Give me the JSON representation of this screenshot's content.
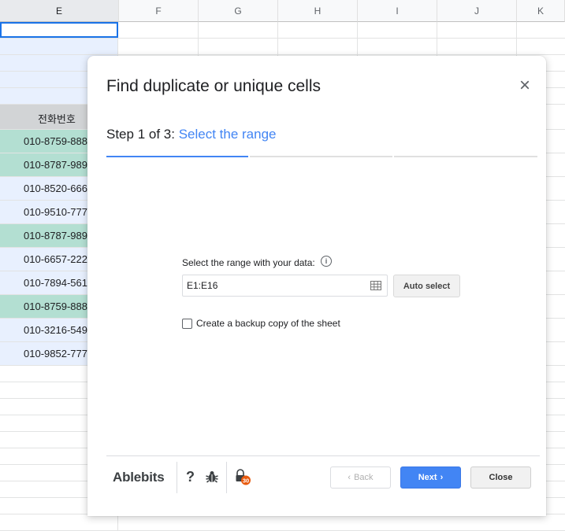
{
  "sheet": {
    "columns": [
      "E",
      "F",
      "G",
      "H",
      "I",
      "J",
      "K"
    ],
    "header_cell": "전화번호",
    "cells": [
      {
        "value": "010-8759-888",
        "highlight": true
      },
      {
        "value": "010-8787-989",
        "highlight": true
      },
      {
        "value": "010-8520-666",
        "highlight": false
      },
      {
        "value": "010-9510-777",
        "highlight": false
      },
      {
        "value": "010-8787-989",
        "highlight": true
      },
      {
        "value": "010-6657-222",
        "highlight": false
      },
      {
        "value": "010-7894-561",
        "highlight": false
      },
      {
        "value": "010-8759-888",
        "highlight": true
      },
      {
        "value": "010-3216-549",
        "highlight": false
      },
      {
        "value": "010-9852-777",
        "highlight": false
      }
    ],
    "colors": {
      "highlight": "#b3dfd2",
      "selected": "#e8f0fe",
      "header_bg": "#d2d4d6"
    }
  },
  "dialog": {
    "title": "Find duplicate or unique cells",
    "close_icon": "×",
    "step_prefix": "Step 1 of 3:",
    "step_name": "Select the range",
    "range_label": "Select the range with your data:",
    "info_icon": "i",
    "range_value": "E1:E16",
    "auto_select_label": "Auto select",
    "backup_label": "Create a backup copy of the sheet",
    "backup_checked": false,
    "footer": {
      "logo": "Ablebits",
      "help_icon": "?",
      "bug_icon": "bug-icon",
      "badge_count": "30",
      "back_label": "Back",
      "next_label": "Next",
      "close_label": "Close"
    },
    "colors": {
      "accent": "#4285f4",
      "badge": "#e8590c"
    }
  }
}
